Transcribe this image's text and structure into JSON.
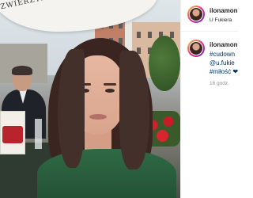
{
  "post": {
    "username": "ilonamon",
    "location": "U Fukiera"
  },
  "photo": {
    "umbrella_text": "ZWIERZYNIEC"
  },
  "caption": {
    "username": "ilonamon",
    "line1": "#cudown",
    "line2": "@u.fukie",
    "line3": "#miłość ❤",
    "time": "16 godz."
  },
  "colors": {
    "link": "#00376b",
    "text": "#262626",
    "muted": "#8e8e8e",
    "ring_start": "#f9ce34",
    "ring_mid": "#ee2a7b",
    "ring_end": "#6228d7",
    "dress": "#2f6a45",
    "hair": "#3a2520"
  },
  "icons": [
    "avatar"
  ]
}
